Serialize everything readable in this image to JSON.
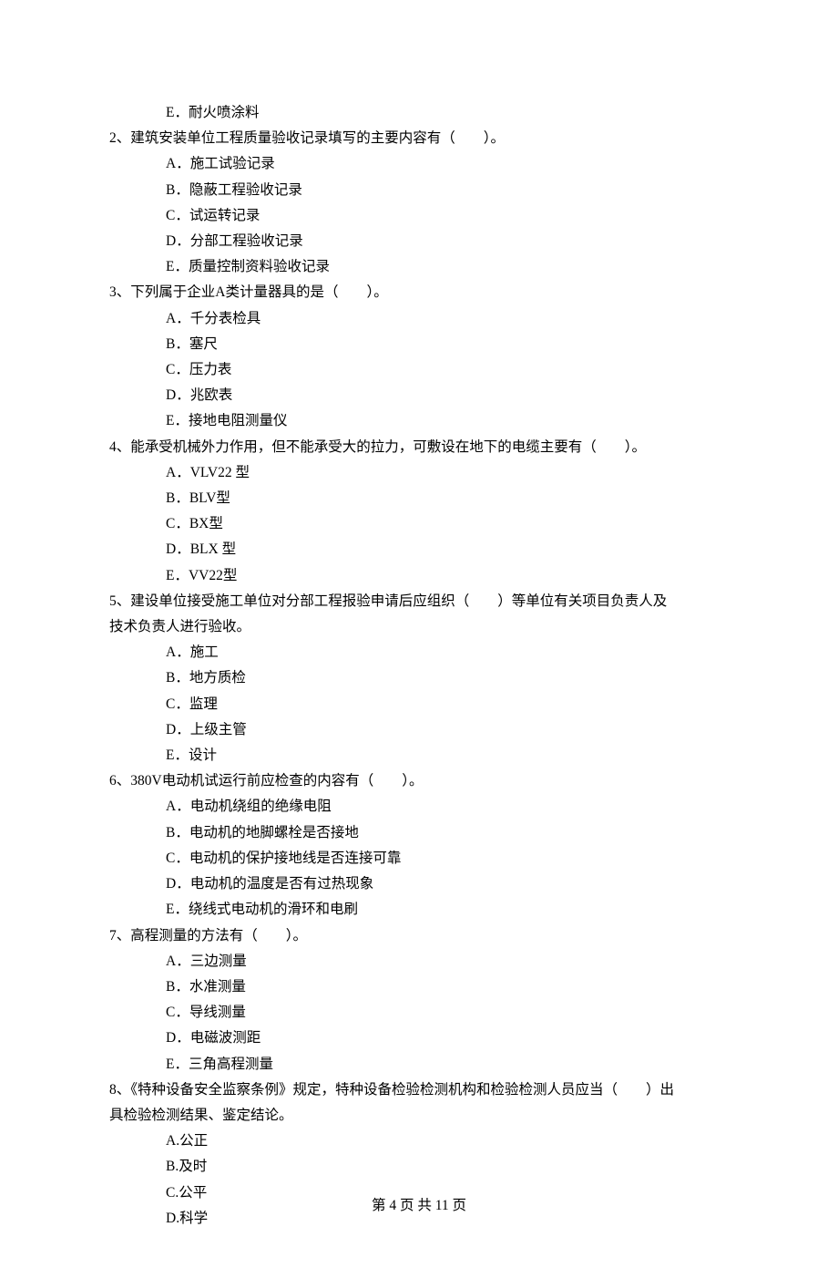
{
  "q1_orphan_option": "E．耐火喷涂料",
  "questions": [
    {
      "num": "2、",
      "stem": "建筑安装单位工程质量验收记录填写的主要内容有（　　）。",
      "options": [
        "A．施工试验记录",
        "B．隐蔽工程验收记录",
        "C．试运转记录",
        "D．分部工程验收记录",
        "E．质量控制资料验收记录"
      ]
    },
    {
      "num": "3、",
      "stem": "下列属于企业A类计量器具的是（　　）。",
      "options": [
        "A．千分表检具",
        "B．塞尺",
        "C．压力表",
        "D．兆欧表",
        "E．接地电阻测量仪"
      ]
    },
    {
      "num": "4、",
      "stem": "能承受机械外力作用，但不能承受大的拉力，可敷设在地下的电缆主要有（　　）。",
      "options": [
        "A．VLV22 型",
        "B．BLV型",
        "C．BX型",
        "D．BLX 型",
        "E．VV22型"
      ]
    },
    {
      "num": "5、",
      "stem": "建设单位接受施工单位对分部工程报验申请后应组织（　　）等单位有关项目负责人及",
      "continuation": "技术负责人进行验收。",
      "options": [
        "A．施工",
        "B．地方质检",
        "C．监理",
        "D．上级主管",
        "E．设计"
      ]
    },
    {
      "num": "6、",
      "stem": "380V电动机试运行前应检查的内容有（　　）。",
      "options": [
        "A．电动机绕组的绝缘电阻",
        "B．电动机的地脚螺栓是否接地",
        "C．电动机的保护接地线是否连接可靠",
        "D．电动机的温度是否有过热现象",
        "E．绕线式电动机的滑环和电刷"
      ]
    },
    {
      "num": "7、",
      "stem": "高程测量的方法有（　　）。",
      "options": [
        "A．三边测量",
        "B．水准测量",
        "C．导线测量",
        "D．电磁波测距",
        "E．三角高程测量"
      ]
    },
    {
      "num": "8、",
      "stem": "《特种设备安全监察条例》规定，特种设备检验检测机构和检验检测人员应当（　　）出",
      "continuation": "具检验检测结果、鉴定结论。",
      "options": [
        "A.公正",
        "B.及时",
        "C.公平",
        "D.科学"
      ]
    }
  ],
  "footer": "第 4 页 共 11 页"
}
